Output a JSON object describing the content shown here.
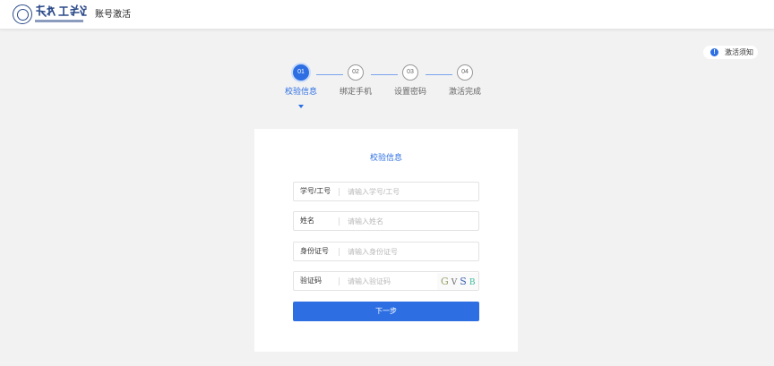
{
  "header": {
    "logo_text": "常州工学院",
    "logo_subtitle": "CHANGZHOU INSTITUTE OF TECHNOLOGY",
    "title": "账号激活"
  },
  "notice": {
    "icon": "info-icon",
    "label": "激活须知"
  },
  "steps": [
    {
      "number": "01",
      "label": "校验信息",
      "active": true
    },
    {
      "number": "02",
      "label": "绑定手机",
      "active": false
    },
    {
      "number": "03",
      "label": "设置密码",
      "active": false
    },
    {
      "number": "04",
      "label": "激活完成",
      "active": false
    }
  ],
  "form": {
    "title": "校验信息",
    "fields": [
      {
        "label": "学号/工号",
        "placeholder": "请输入学号/工号",
        "value": ""
      },
      {
        "label": "姓名",
        "placeholder": "请输入姓名",
        "value": ""
      },
      {
        "label": "身份证号",
        "placeholder": "请输入身份证号",
        "value": ""
      },
      {
        "label": "验证码",
        "placeholder": "请输入验证码",
        "value": ""
      }
    ],
    "captcha_text": [
      "G",
      "V",
      "S",
      "B"
    ],
    "submit_label": "下一步"
  },
  "colors": {
    "accent": "#2d6fe3",
    "background": "#f2f2f2",
    "connector": "#7aa3ee"
  }
}
